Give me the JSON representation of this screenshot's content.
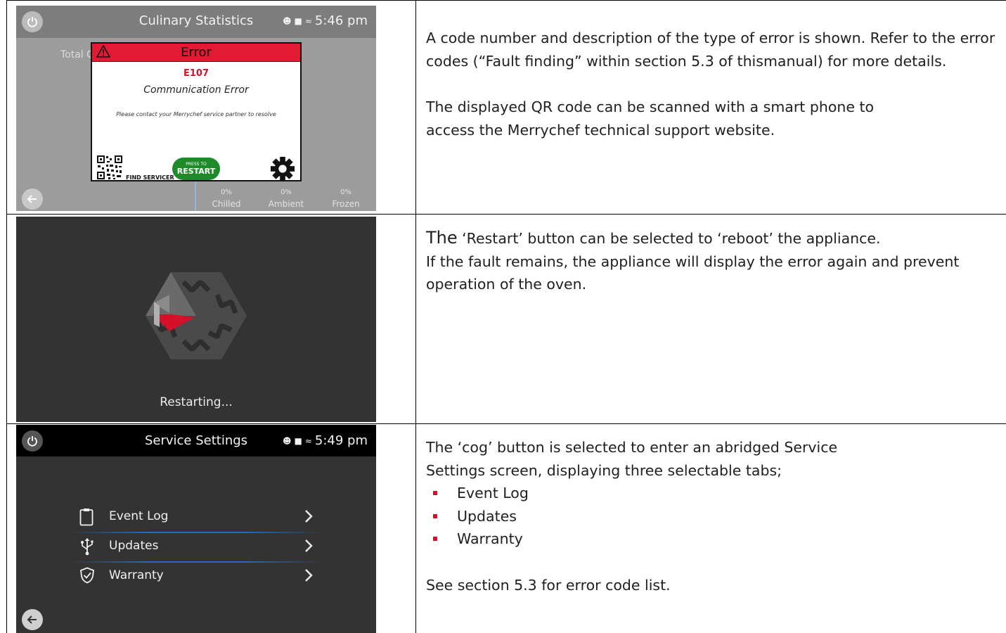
{
  "screen1": {
    "title": "Culinary Statistics",
    "time": "5:46 pm",
    "totals_label": "Total C",
    "dialog": {
      "title": "Error",
      "code": "E107",
      "description": "Communication Error",
      "hint": "Please contact your Merrychef service partner to resolve",
      "find_servicer": "FIND SERVICER",
      "restart_small": "PRESS TO",
      "restart_big": "RESTART"
    },
    "stats": [
      {
        "pct": "0%",
        "label": "Chilled"
      },
      {
        "pct": "0%",
        "label": "Ambient"
      },
      {
        "pct": "0%",
        "label": "Frozen"
      }
    ]
  },
  "screen2": {
    "status_text": "Restarting..."
  },
  "screen3": {
    "title": "Service Settings",
    "time": "5:49 pm",
    "items": [
      {
        "label": "Event Log",
        "icon": "clipboard-icon"
      },
      {
        "label": "Updates",
        "icon": "usb-icon"
      },
      {
        "label": "Warranty",
        "icon": "shield-check-icon"
      }
    ]
  },
  "descriptions": {
    "row1": {
      "para1": "A code number and description of the type of error is shown. Refer to the error codes (“Fault finding” within section 5.3 of thismanual) for more details.",
      "para2": "The displayed QR code can be scanned with a smart phone to access the Merrychef technical support website."
    },
    "row2": {
      "lead": "The",
      "para1_rest": " ‘Restart’ button can be selected to ‘reboot’ the appliance.",
      "para2": "If the fault remains, the appliance will display the error again and prevent operation of the oven."
    },
    "row3": {
      "intro": "The ‘cog’ button is selected to enter an abridged Service Settings screen, displaying three selectable tabs;",
      "bullets": [
        "Event Log",
        "Updates",
        "Warranty"
      ],
      "footer": "See section 5.3 for error code list."
    }
  },
  "colors": {
    "error_red": "#e21a33",
    "restart_green": "#1e8a2a",
    "bullet_red": "#d4102a",
    "separator_blue": "#1a6cc4"
  }
}
